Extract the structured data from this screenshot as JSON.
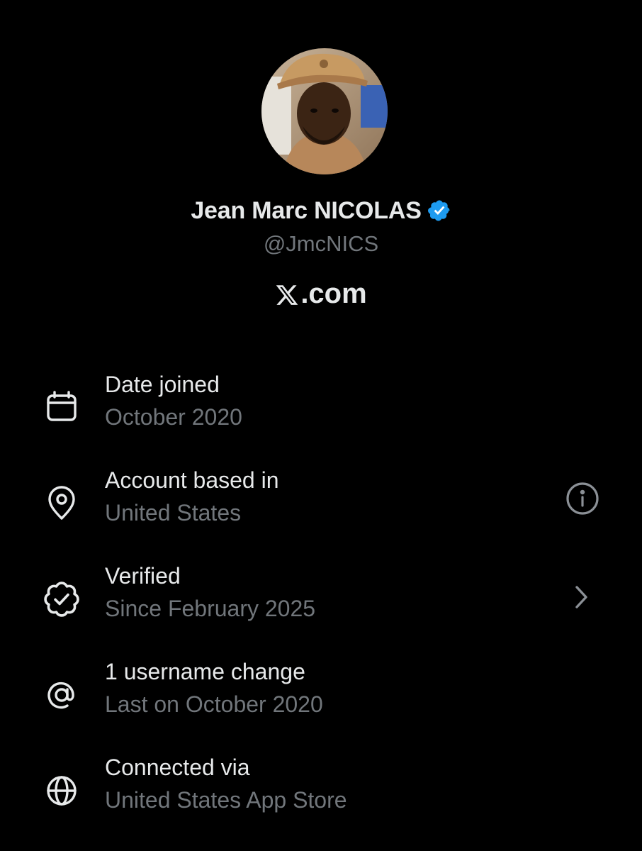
{
  "profile": {
    "display_name": "Jean Marc NICOLAS",
    "handle": "@JmcNICS",
    "verified": true,
    "verified_color": "#1d9bf0",
    "site_text": ".com",
    "site_logo": "x-logo-icon"
  },
  "about": {
    "items": [
      {
        "icon": "calendar-icon",
        "title": "Date joined",
        "subtitle": "October 2020"
      },
      {
        "icon": "location-pin-icon",
        "title": "Account based in",
        "subtitle": "United States",
        "trailing_icon": "info-icon"
      },
      {
        "icon": "verified-badge-outline-icon",
        "title": "Verified",
        "subtitle": "Since February 2025",
        "trailing_icon": "chevron-right-icon"
      },
      {
        "icon": "at-sign-icon",
        "title": "1 username change",
        "subtitle": "Last on October 2020"
      },
      {
        "icon": "globe-icon",
        "title": "Connected via",
        "subtitle": "United States App Store"
      }
    ]
  },
  "colors": {
    "background": "#000000",
    "primary_text": "#e7e9ea",
    "secondary_text": "#71767b",
    "icon": "#e7e9ea",
    "trailing_icon": "#8b9096"
  }
}
